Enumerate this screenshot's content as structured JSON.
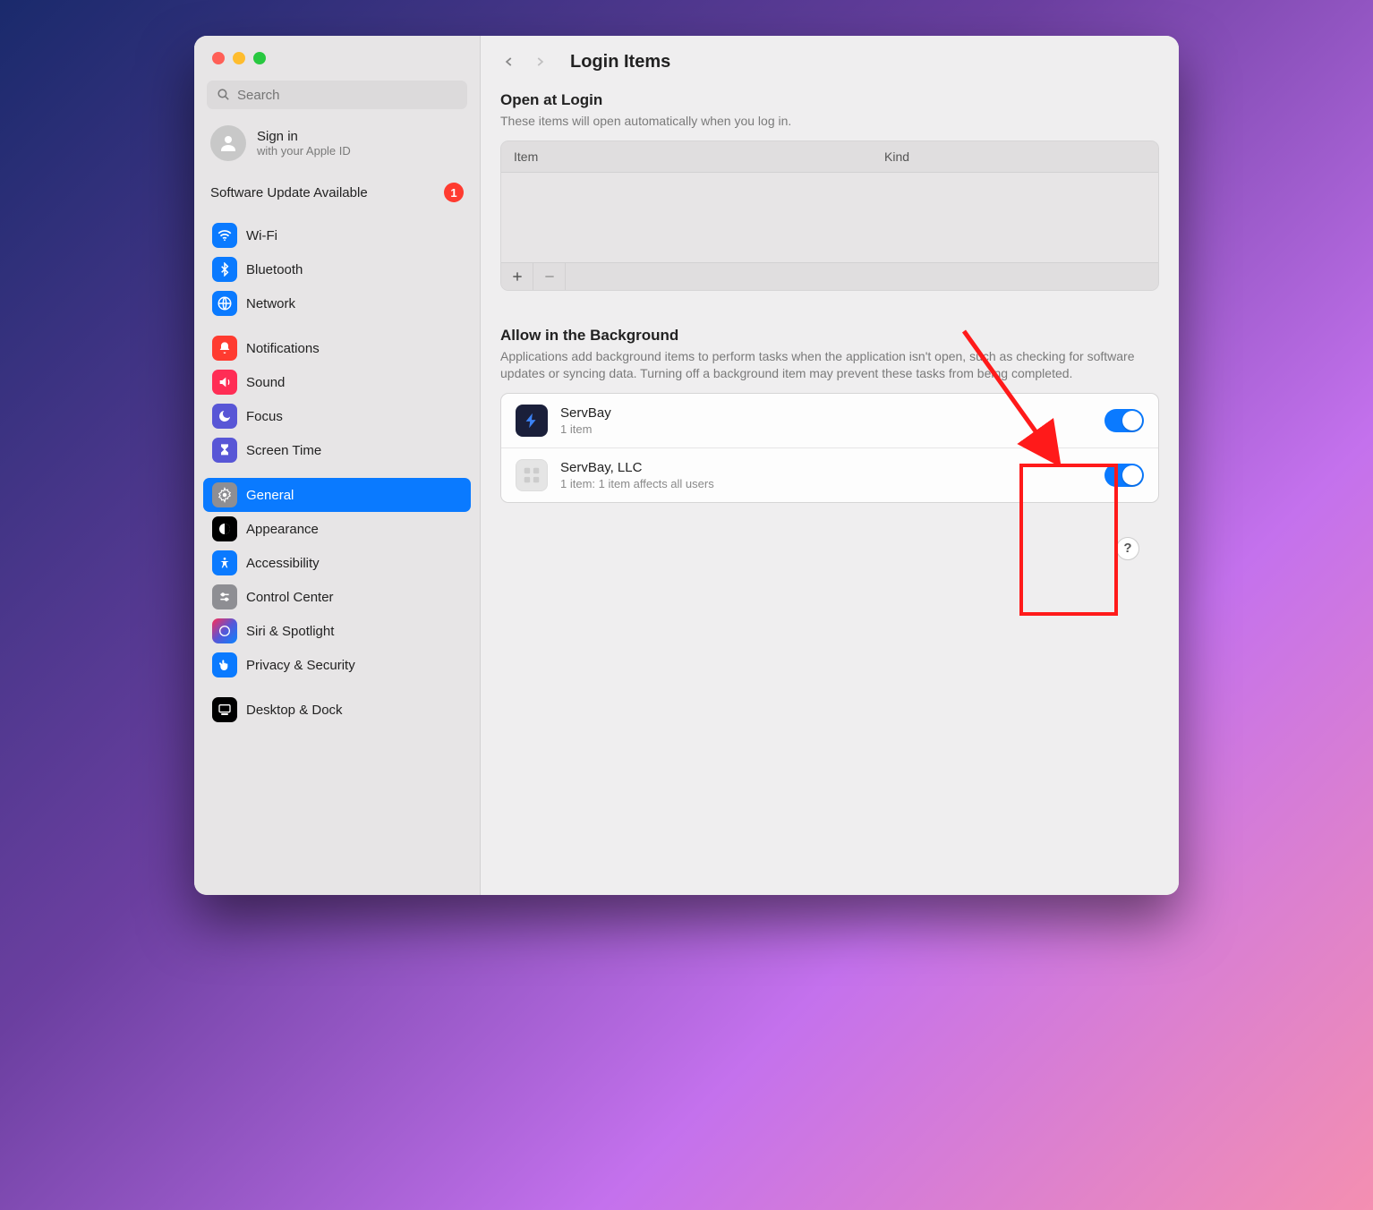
{
  "search": {
    "placeholder": "Search"
  },
  "signin": {
    "title": "Sign in",
    "sub": "with your Apple ID"
  },
  "update": {
    "label": "Software Update Available",
    "count": "1"
  },
  "sidebar": {
    "group1": [
      {
        "label": "Wi-Fi"
      },
      {
        "label": "Bluetooth"
      },
      {
        "label": "Network"
      }
    ],
    "group2": [
      {
        "label": "Notifications"
      },
      {
        "label": "Sound"
      },
      {
        "label": "Focus"
      },
      {
        "label": "Screen Time"
      }
    ],
    "group3": [
      {
        "label": "General"
      },
      {
        "label": "Appearance"
      },
      {
        "label": "Accessibility"
      },
      {
        "label": "Control Center"
      },
      {
        "label": "Siri & Spotlight"
      },
      {
        "label": "Privacy & Security"
      }
    ],
    "group4": [
      {
        "label": "Desktop & Dock"
      }
    ]
  },
  "page": {
    "title": "Login Items"
  },
  "open_at_login": {
    "title": "Open at Login",
    "sub": "These items will open automatically when you log in.",
    "col_item": "Item",
    "col_kind": "Kind"
  },
  "allow_bg": {
    "title": "Allow in the Background",
    "sub": "Applications add background items to perform tasks when the application isn't open, such as checking for software updates or syncing data. Turning off a background item may prevent these tasks from being completed.",
    "rows": [
      {
        "name": "ServBay",
        "detail": "1 item",
        "on": true
      },
      {
        "name": "ServBay, LLC",
        "detail": "1 item: 1 item affects all users",
        "on": true
      }
    ]
  },
  "help": "?"
}
